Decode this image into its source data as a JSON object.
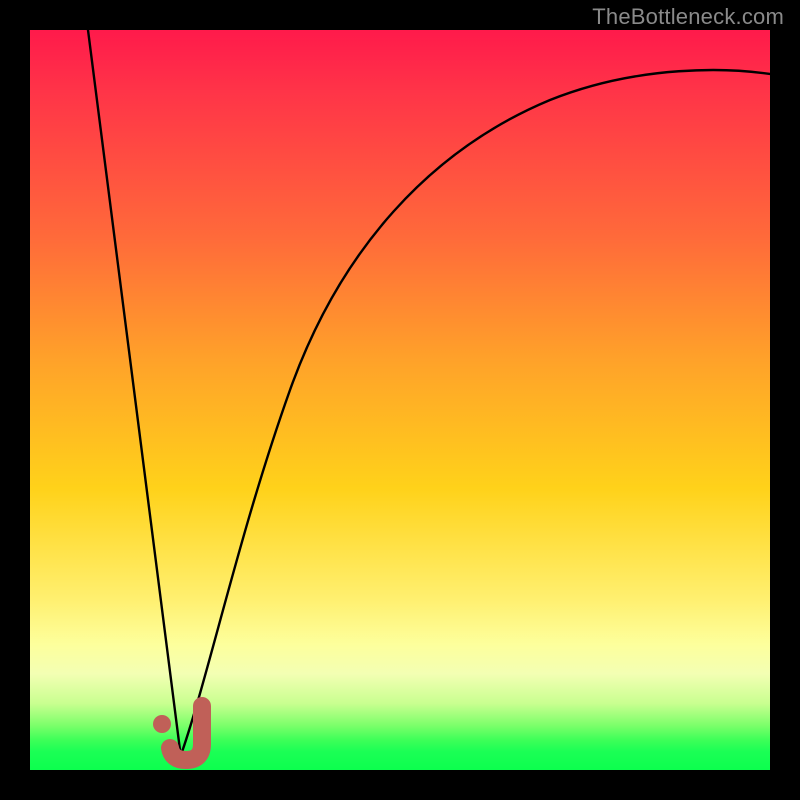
{
  "watermark": "TheBottleneck.com",
  "chart_data": {
    "type": "line",
    "title": "",
    "xlabel": "",
    "ylabel": "",
    "xlim": [
      0,
      100
    ],
    "ylim": [
      0,
      100
    ],
    "grid": false,
    "series": [
      {
        "name": "bottleneck-curve",
        "x": [
          0,
          5,
          10,
          14,
          17,
          19,
          20,
          21,
          23,
          26,
          30,
          35,
          41,
          48,
          56,
          64,
          72,
          80,
          88,
          96,
          100
        ],
        "y": [
          100,
          77,
          52,
          30,
          14,
          4,
          1,
          2,
          8,
          20,
          36,
          52,
          64,
          74,
          81,
          86,
          89.5,
          92,
          93.5,
          94.5,
          95
        ]
      }
    ],
    "annotations": [
      {
        "name": "minimum-marker-J",
        "x": 20,
        "y": 2
      }
    ]
  }
}
